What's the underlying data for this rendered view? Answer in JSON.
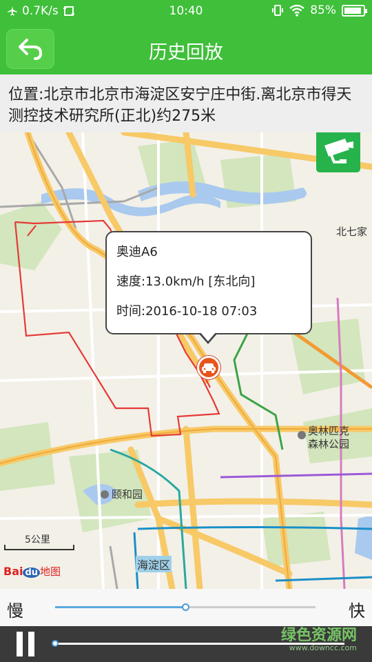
{
  "status_bar": {
    "net_speed": "0.7K/s",
    "time": "10:40",
    "battery": "85%"
  },
  "header": {
    "title": "历史回放",
    "back_icon": "back-arrow-icon"
  },
  "location_text": "位置:北京市北京市海淀区安宁庄中街.离北京市得天测控技术研究所(正北)约275米",
  "map": {
    "labels": {
      "beiqijia": "北七家",
      "olympic_park": "奥林匹克\n森林公园",
      "summer_palace": "颐和园",
      "haidian": "海淀区"
    },
    "scale": "5公里",
    "logo_bai": "Bai",
    "logo_du": "du",
    "logo_map": "地图",
    "camera_icon": "video-camera-icon"
  },
  "popup": {
    "vehicle": "奥迪A6",
    "speed": "速度:13.0km/h [东北向]",
    "time": "时间:2016-10-18 07:03"
  },
  "speed_control": {
    "slow_label": "慢",
    "fast_label": "快",
    "value_fraction": 0.5
  },
  "playback": {
    "progress_fraction": 0.0,
    "watermark": "绿色资源网",
    "watermark_url": "www.downcc.com"
  },
  "colors": {
    "primary_green": "#3fbf3a",
    "track_red": "#e53935",
    "marker_orange": "#e8541c",
    "slider_blue": "#5aa9e0"
  }
}
